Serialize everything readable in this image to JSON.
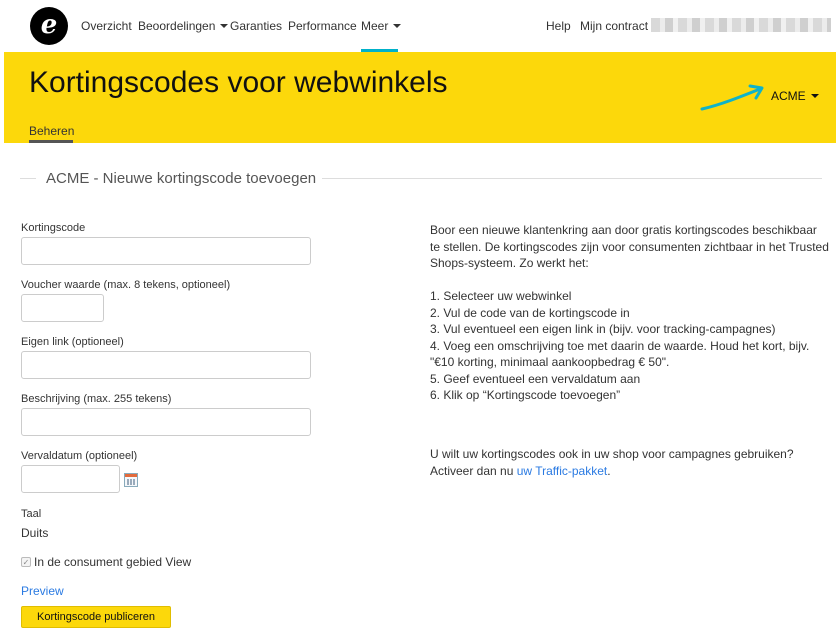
{
  "nav": {
    "logo_letter": "e",
    "items": [
      {
        "label": "Overzicht",
        "dropdown": false
      },
      {
        "label": "Beoordelingen",
        "dropdown": true
      },
      {
        "label": "Garanties",
        "dropdown": false
      },
      {
        "label": "Performance",
        "dropdown": false
      },
      {
        "label": "Meer",
        "dropdown": true,
        "active": true
      }
    ],
    "right_items": [
      "Help",
      "Mijn contract"
    ],
    "accent_color": "#00b1c9"
  },
  "header": {
    "title": "Kortingscodes voor webwinkels",
    "shop_selector": "ACME",
    "tab": "Beheren",
    "background_color": "#fcd80b"
  },
  "section": {
    "title": "ACME - Nieuwe kortingscode toevoegen"
  },
  "form": {
    "code_label": "Kortingscode",
    "code_value": "",
    "voucher_label": "Voucher waarde (max. 8 tekens, optioneel)",
    "voucher_value": "",
    "link_label": "Eigen link (optioneel)",
    "link_value": "",
    "description_label": "Beschrijving (max. 255 tekens)",
    "description_value": "",
    "expiry_label": "Vervaldatum (optioneel)",
    "expiry_value": "",
    "language_label": "Taal",
    "language_value": "Duits",
    "checkbox_label": "In de consument gebied View",
    "checkbox_checked": true,
    "preview_link": "Preview",
    "publish_button": "Kortingscode publiceren"
  },
  "info": {
    "intro": "Boor een nieuwe klantenkring aan door gratis kortingscodes beschikbaar te stellen. De kortingscodes zijn voor consumenten zichtbaar in het Trusted Shops-systeem. Zo werkt het:",
    "steps": [
      "1. Selecteer uw webwinkel",
      "2. Vul de code van de kortingscode in",
      "3. Vul eventueel een eigen link in (bijv. voor tracking-campagnes)",
      "4. Voeg een omschrijving toe met daarin de waarde. Houd het kort, bijv. \"€10 korting, minimaal aankoopbedrag € 50\".",
      "5. Geef eventueel een vervaldatum aan",
      "6. Klik op “Kortingscode toevoegen”"
    ],
    "traffic_text": "U wilt uw kortingscodes ook in uw shop voor campagnes gebruiken? Activeer dan nu",
    "traffic_link": "uw Traffic-pakket",
    "traffic_end": "."
  },
  "icons": {
    "logo": "trusted-shops-e-logo",
    "arrow": "curved-arrow-icon",
    "calendar": "calendar-icon",
    "checkbox": "checkmark-icon"
  }
}
